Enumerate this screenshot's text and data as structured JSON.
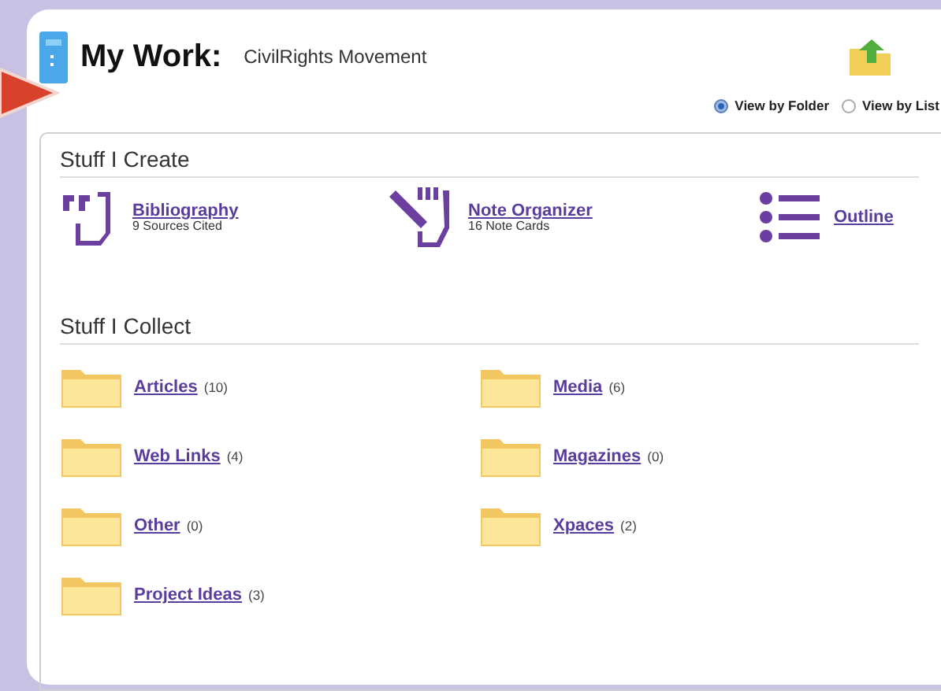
{
  "header": {
    "title": "My Work:",
    "subtitle": "CivilRights Movement"
  },
  "view_options": [
    {
      "label": "View by Folder",
      "selected": true
    },
    {
      "label": "View by List",
      "selected": false
    }
  ],
  "create": {
    "heading": "Stuff I Create",
    "items": [
      {
        "kind": "quote",
        "label": "Bibliography",
        "detail": "9 Sources Cited"
      },
      {
        "kind": "notes",
        "label": "Note Organizer",
        "detail": "16 Note Cards"
      },
      {
        "kind": "outline",
        "label": "Outline"
      }
    ]
  },
  "collect": {
    "heading": "Stuff I Collect",
    "folders": [
      {
        "label": "Articles",
        "count": "(10)"
      },
      {
        "label": "Media",
        "count": "(6)"
      },
      {
        "label": "Web Links",
        "count": "(4)"
      },
      {
        "label": "Magazines",
        "count": "(0)"
      },
      {
        "label": "Other",
        "count": "(0)"
      },
      {
        "label": "Xpaces",
        "count": "(2)"
      },
      {
        "label": "Project Ideas",
        "count": "(3)"
      }
    ]
  }
}
